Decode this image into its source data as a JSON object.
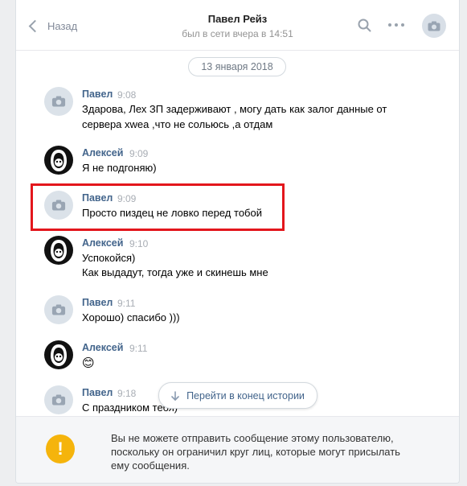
{
  "header": {
    "back_label": "Назад",
    "title": "Павел Рейз",
    "subtitle": "был в сети вчера в 14:51"
  },
  "date_separator": "13 января 2018",
  "messages": [
    {
      "author": "Павел",
      "time": "9:08",
      "avatar": "camera-icon",
      "lines": [
        "Здарова, Лех ЗП задерживают , могу дать как залог данные от",
        "сервера xwea ,что не сольюсь ,а отдам"
      ]
    },
    {
      "author": "Алексей",
      "time": "9:09",
      "avatar": "hooded-figure-icon",
      "lines": [
        "Я не подгоняю)"
      ]
    },
    {
      "author": "Павел",
      "time": "9:09",
      "avatar": "camera-icon",
      "lines": [
        "Просто пиздец не ловко перед тобой"
      ]
    },
    {
      "author": "Алексей",
      "time": "9:10",
      "avatar": "hooded-figure-icon",
      "lines": [
        "Успокойся)",
        "Как выдадут, тогда уже и скинешь мне"
      ]
    },
    {
      "author": "Павел",
      "time": "9:11",
      "avatar": "camera-icon",
      "lines": [
        "Хорошо) спасибо )))"
      ]
    },
    {
      "author": "Алексей",
      "time": "9:11",
      "avatar": "hooded-figure-icon",
      "lines": [
        "😊"
      ]
    },
    {
      "author": "Павел",
      "time": "9:18",
      "avatar": "camera-icon",
      "lines": [
        "С праздником тебя)"
      ]
    }
  ],
  "jump_button": "Перейти в конец истории",
  "notice": {
    "lines": [
      "Вы не можете отправить сообщение этому пользователю,",
      "поскольку он ограничил круг лиц, которые могут присылать",
      "ему сообщения."
    ],
    "icon": "!"
  },
  "colors": {
    "link": "#42648b",
    "warning": "#f5b40c",
    "highlight": "#e3161c"
  }
}
